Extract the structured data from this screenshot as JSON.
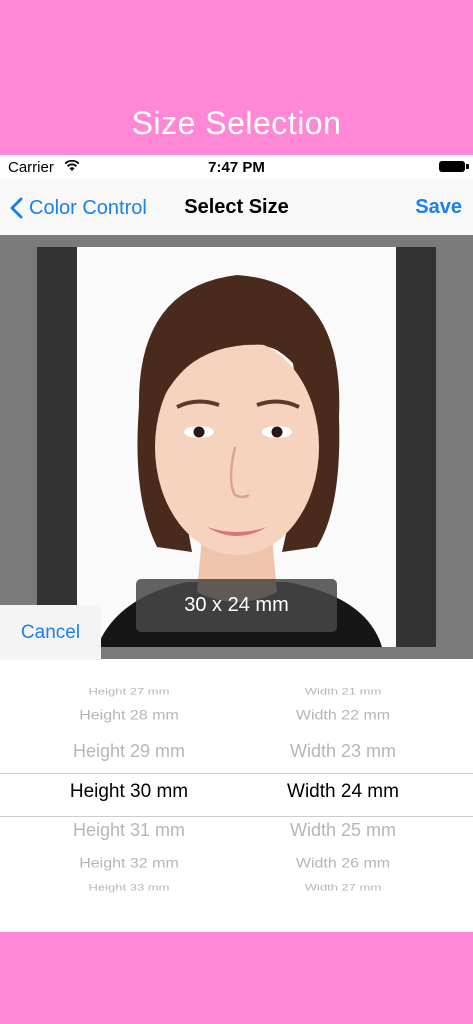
{
  "banner": {
    "title": "Size Selection"
  },
  "status_bar": {
    "carrier": "Carrier",
    "time": "7:47 PM"
  },
  "navbar": {
    "back_label": "Color Control",
    "title": "Select Size",
    "save_label": "Save"
  },
  "preview": {
    "size_label": "30 x 24 mm"
  },
  "cancel_label": "Cancel",
  "picker": {
    "height": {
      "rows": [
        "Height 27 mm",
        "Height 28 mm",
        "Height 29 mm",
        "Height 30 mm",
        "Height 31 mm",
        "Height 32 mm",
        "Height 33 mm"
      ],
      "selected": "Height 30 mm"
    },
    "width": {
      "rows": [
        "Width 21 mm",
        "Width 22 mm",
        "Width 23 mm",
        "Width 24 mm",
        "Width 25 mm",
        "Width 26 mm",
        "Width 27 mm"
      ],
      "selected": "Width 24 mm"
    }
  },
  "colors": {
    "banner": "#ff88d6",
    "accent": "#1a7ff0",
    "preview_bg": "#7a7a7a"
  }
}
